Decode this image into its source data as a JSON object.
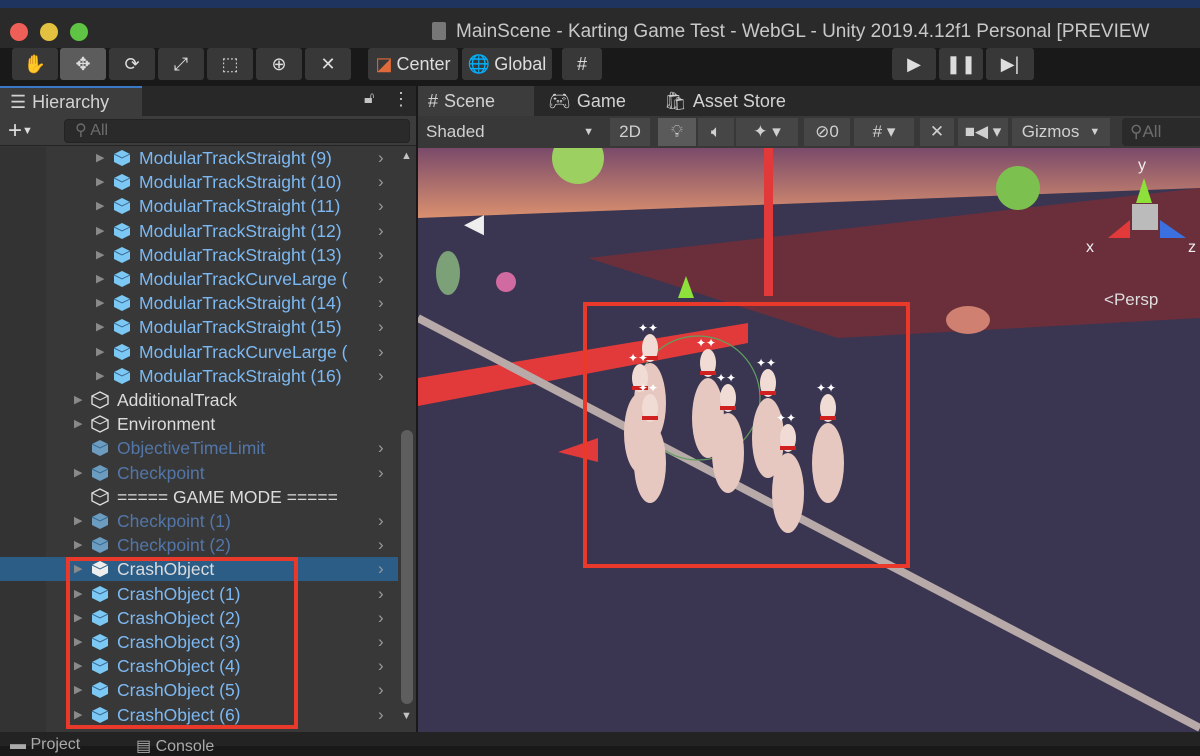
{
  "window": {
    "title": "MainScene - Karting Game Test - WebGL - Unity 2019.4.12f1 Personal [PREVIEW"
  },
  "toolbar": {
    "tools": [
      "hand-tool",
      "move-tool",
      "rotate-tool",
      "scale-tool",
      "rect-tool",
      "transform-tool",
      "custom-tool"
    ],
    "active_tool": "move-tool",
    "pivot_label": "Center",
    "space_label": "Global",
    "play": "play",
    "pause": "pause",
    "step": "step"
  },
  "hierarchy": {
    "tab_label": "Hierarchy",
    "search_placeholder": "All",
    "rows": [
      {
        "label": "ModularTrackStraight (9)",
        "style": "blue",
        "depth": 2,
        "arrow": true,
        "chevron": true
      },
      {
        "label": "ModularTrackStraight (10)",
        "style": "blue",
        "depth": 2,
        "arrow": true,
        "chevron": true
      },
      {
        "label": "ModularTrackStraight (11)",
        "style": "blue",
        "depth": 2,
        "arrow": true,
        "chevron": true
      },
      {
        "label": "ModularTrackStraight (12)",
        "style": "blue",
        "depth": 2,
        "arrow": true,
        "chevron": true
      },
      {
        "label": "ModularTrackStraight (13)",
        "style": "blue",
        "depth": 2,
        "arrow": true,
        "chevron": true
      },
      {
        "label": "ModularTrackCurveLarge (",
        "style": "blue",
        "depth": 2,
        "arrow": true,
        "chevron": true
      },
      {
        "label": "ModularTrackStraight (14)",
        "style": "blue",
        "depth": 2,
        "arrow": true,
        "chevron": true
      },
      {
        "label": "ModularTrackStraight (15)",
        "style": "blue",
        "depth": 2,
        "arrow": true,
        "chevron": true
      },
      {
        "label": "ModularTrackCurveLarge (",
        "style": "blue",
        "depth": 2,
        "arrow": true,
        "chevron": true
      },
      {
        "label": "ModularTrackStraight (16)",
        "style": "blue",
        "depth": 2,
        "arrow": true,
        "chevron": true
      },
      {
        "label": "AdditionalTrack",
        "style": "white",
        "depth": 1,
        "arrow": true,
        "chevron": false
      },
      {
        "label": "Environment",
        "style": "white",
        "depth": 1,
        "arrow": true,
        "chevron": false
      },
      {
        "label": "ObjectiveTimeLimit",
        "style": "dim",
        "depth": 1,
        "arrow": false,
        "chevron": true
      },
      {
        "label": "Checkpoint",
        "style": "dim",
        "depth": 1,
        "arrow": true,
        "chevron": true
      },
      {
        "label": "===== GAME MODE =====",
        "style": "white",
        "depth": 1,
        "arrow": false,
        "chevron": false
      },
      {
        "label": "Checkpoint (1)",
        "style": "dim",
        "depth": 1,
        "arrow": true,
        "chevron": true
      },
      {
        "label": "Checkpoint (2)",
        "style": "dim",
        "depth": 1,
        "arrow": true,
        "chevron": true
      },
      {
        "label": "CrashObject",
        "style": "selected",
        "depth": 1,
        "arrow": true,
        "chevron": true
      },
      {
        "label": "CrashObject (1)",
        "style": "blue",
        "depth": 1,
        "arrow": true,
        "chevron": true
      },
      {
        "label": "CrashObject (2)",
        "style": "blue",
        "depth": 1,
        "arrow": true,
        "chevron": true
      },
      {
        "label": "CrashObject (3)",
        "style": "blue",
        "depth": 1,
        "arrow": true,
        "chevron": true
      },
      {
        "label": "CrashObject (4)",
        "style": "blue",
        "depth": 1,
        "arrow": true,
        "chevron": true
      },
      {
        "label": "CrashObject (5)",
        "style": "blue",
        "depth": 1,
        "arrow": true,
        "chevron": true
      },
      {
        "label": "CrashObject (6)",
        "style": "blue",
        "depth": 1,
        "arrow": true,
        "chevron": true
      }
    ]
  },
  "tabs": {
    "scene": "Scene",
    "game": "Game",
    "asset_store": "Asset Store"
  },
  "scene_toolbar": {
    "shading": "Shaded",
    "mode_2d": "2D",
    "hidden_count": "0",
    "gizmos": "Gizmos",
    "search_placeholder": "All"
  },
  "scene": {
    "persp_label": "Persp",
    "axis_y": "y",
    "axis_x": "x",
    "axis_z": "z"
  },
  "bottom_tabs": {
    "project": "Project",
    "console": "Console"
  },
  "colors": {
    "highlight": "#e8392a",
    "prefab_blue": "#7cb9f3",
    "selection": "#2c5d87"
  }
}
